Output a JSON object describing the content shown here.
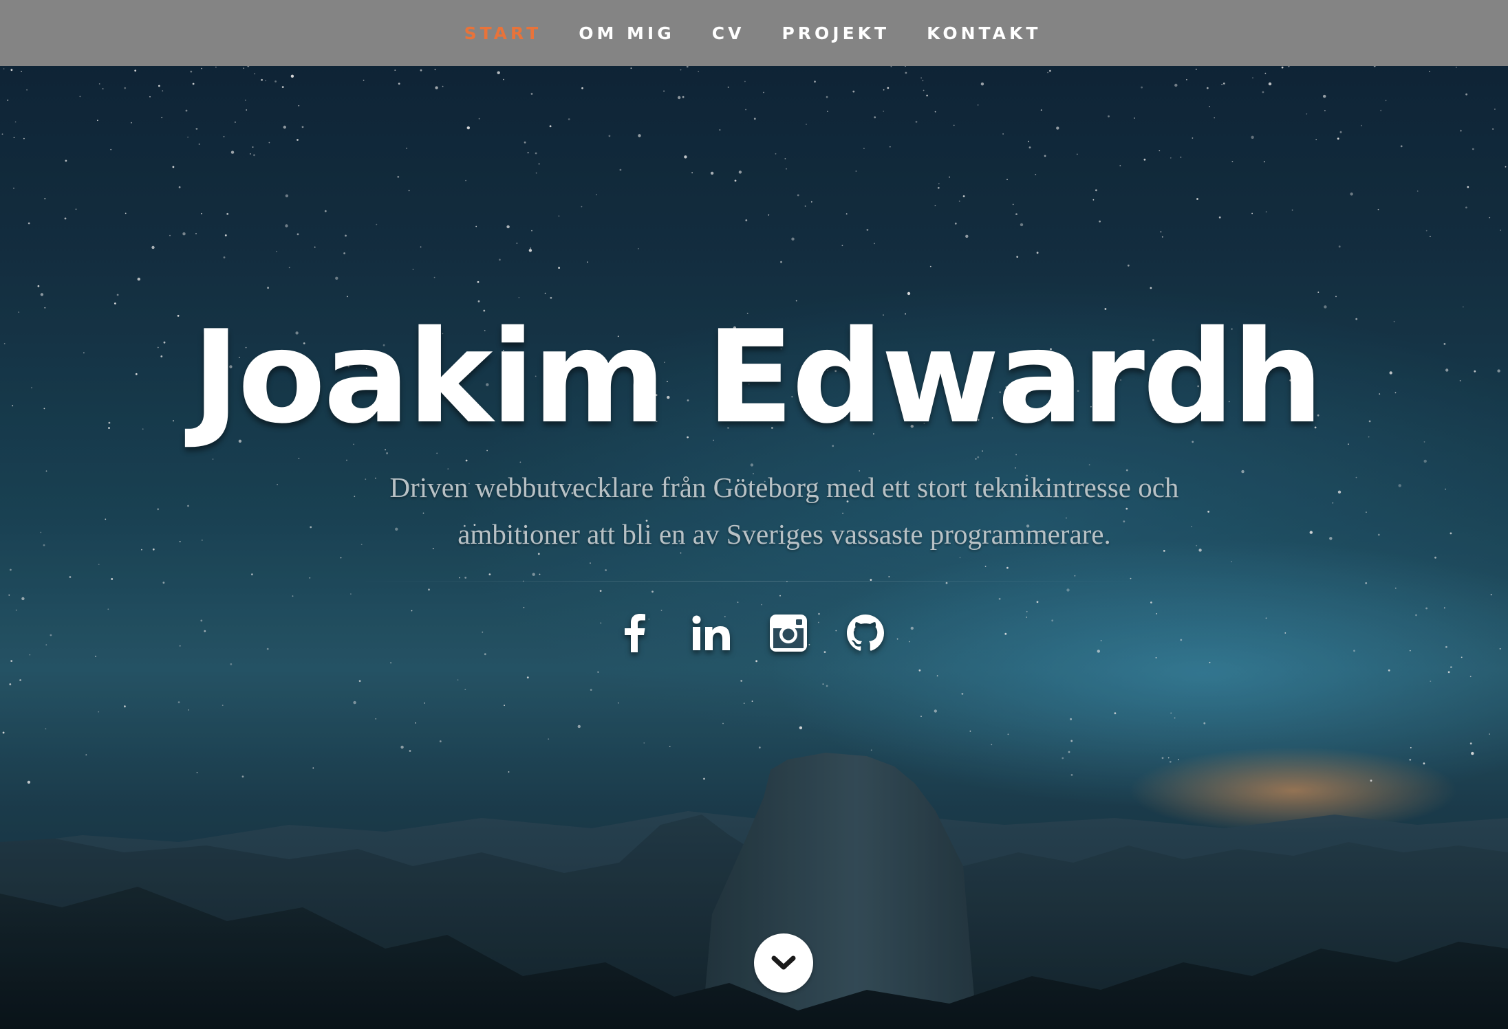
{
  "nav": {
    "items": [
      {
        "label": "START",
        "active": true
      },
      {
        "label": "OM MIG",
        "active": false
      },
      {
        "label": "CV",
        "active": false
      },
      {
        "label": "PROJEKT",
        "active": false
      },
      {
        "label": "KONTAKT",
        "active": false
      }
    ],
    "background_color": "#848484",
    "active_color": "#e8733a"
  },
  "hero": {
    "name": "Joakim Edwardh",
    "tagline_line1": "Driven webbutvecklare från Göteborg med ett stort teknikintresse och",
    "tagline_line2": "ambitioner att bli en av Sveriges vassaste programmerare."
  },
  "social": [
    {
      "icon": "facebook-icon"
    },
    {
      "icon": "linkedin-icon"
    },
    {
      "icon": "instagram-icon"
    },
    {
      "icon": "github-icon"
    }
  ],
  "scroll_button": {
    "icon": "chevron-down-icon"
  }
}
